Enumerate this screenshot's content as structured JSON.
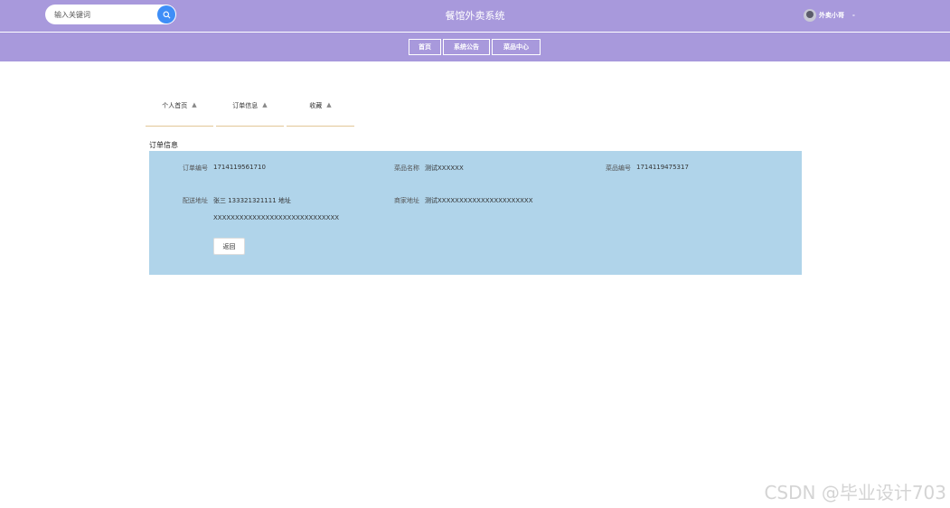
{
  "header": {
    "search_placeholder": "输入关键词",
    "title": "餐馆外卖系统",
    "user_name": "外卖小哥",
    "caret": "-"
  },
  "nav": {
    "tabs": [
      {
        "label": "首页"
      },
      {
        "label": "系统公告"
      },
      {
        "label": "菜品中心"
      }
    ]
  },
  "center_menu": {
    "items": [
      {
        "label": "个人首页"
      },
      {
        "label": "订单信息"
      },
      {
        "label": "收藏"
      }
    ]
  },
  "order": {
    "section_title": "订单信息",
    "order_no_label": "订单编号",
    "order_no": "1714119561710",
    "dish_name_label": "菜品名称",
    "dish_name": "测试XXXXXX",
    "dish_no_label": "菜品编号",
    "dish_no": "1714119475317",
    "delivery_addr_label": "配送地址",
    "delivery_addr": "张三 133321321111 地址",
    "delivery_addr_cont": "XXXXXXXXXXXXXXXXXXXXXXXXXXXXX",
    "shop_addr_label": "商家地址",
    "shop_addr": "测试XXXXXXXXXXXXXXXXXXXXXX",
    "back_label": "返回"
  },
  "watermark": "CSDN @毕业设计703"
}
